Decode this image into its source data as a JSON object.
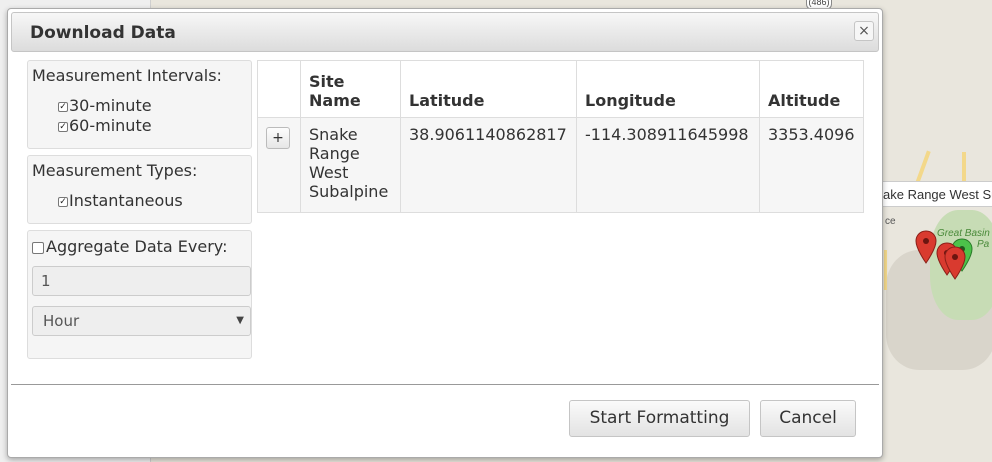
{
  "dialog": {
    "title": "Download Data",
    "close_icon": "×"
  },
  "measurement_intervals": {
    "title": "Measurement Intervals:",
    "options": [
      {
        "label": "30-minute",
        "checked": true
      },
      {
        "label": "60-minute",
        "checked": true
      }
    ]
  },
  "measurement_types": {
    "title": "Measurement Types:",
    "options": [
      {
        "label": "Instantaneous",
        "checked": true
      }
    ]
  },
  "aggregate": {
    "label": "Aggregate Data Every:",
    "checked": false,
    "value": "1",
    "unit": "Hour"
  },
  "check_mark": "✓",
  "table": {
    "headers": [
      "Site Name",
      "Latitude",
      "Longitude",
      "Altitude"
    ],
    "rows": [
      {
        "expand": "+",
        "site_name": "Snake Range West Subalpine",
        "latitude": "38.9061140862817",
        "longitude": "-114.308911645998",
        "altitude": "3353.4096"
      }
    ]
  },
  "buttons": {
    "start": "Start Formatting",
    "cancel": "Cancel"
  },
  "map": {
    "popup_label": "ake Range West Su",
    "park_label_1": "Great Basin",
    "park_label_2": "Pa",
    "road_shield": "(486)",
    "side_text": "ce",
    "pin_colors": {
      "red": "#d93a2f",
      "green": "#4cc24a"
    }
  }
}
